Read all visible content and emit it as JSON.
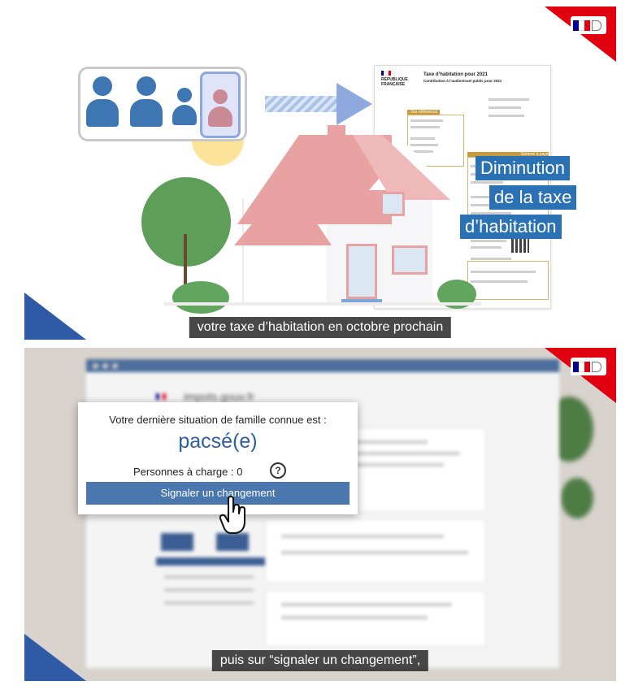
{
  "top_frame": {
    "blue_labels": [
      "Diminution",
      "de la taxe",
      "d’habitation"
    ],
    "subtitle": "votre taxe d’habitation en octobre prochain",
    "document": {
      "header_left": "RÉPUBLIQUE FRANÇAISE",
      "title_line1": "Taxe d’habitation pour 2021",
      "title_line2": "Contribution à l’audiovisuel public pour 2021",
      "section_refs": "Vos références",
      "section_pay": "Somme à payer"
    }
  },
  "bottom_frame": {
    "site_name": "impots.gouv.fr",
    "popup": {
      "known_situation": "Votre dernière situation de famille connue est :",
      "status": "pacsé(e)",
      "dependents": "Personnes à charge : 0",
      "help_symbol": "?",
      "button_label": "Signaler un changement"
    },
    "subtitle": "puis sur “signaler un changement”,"
  },
  "icons": [
    "marianne-logo-icon",
    "person-icon",
    "arrow-right-icon",
    "house-icon",
    "hand-cursor-icon",
    "help-icon"
  ],
  "colors": {
    "accent_blue": "#2b72b4",
    "flag_red": "#e1000f",
    "corner_blue": "#2f5aa6",
    "status_blue": "#2c5fa0",
    "button_blue": "#4a77ad"
  }
}
